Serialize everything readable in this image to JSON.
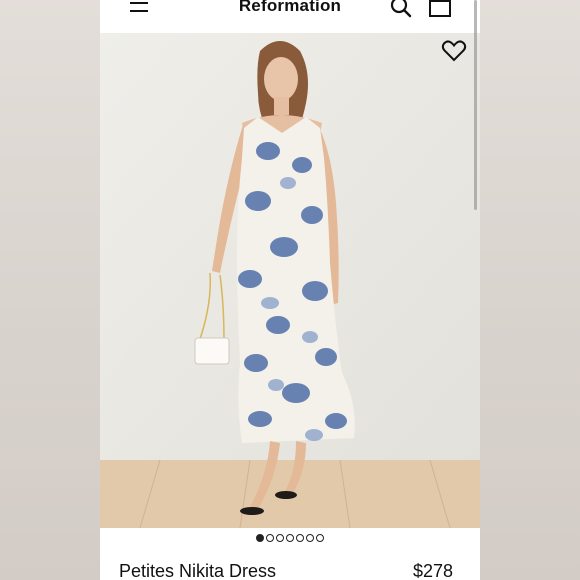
{
  "header": {
    "brand": "Reformation",
    "menu_icon": "hamburger-menu-icon",
    "search_icon": "search-icon",
    "bag_icon": "shopping-bag-icon"
  },
  "gallery": {
    "image_count": 7,
    "active_index": 0,
    "favorite_icon": "heart-icon"
  },
  "product": {
    "name": "Petites Nikita Dress",
    "price": "$278"
  },
  "colors": {
    "text": "#111111",
    "dress_blue": "#4f6fa8",
    "background": "#e9e7e2"
  }
}
